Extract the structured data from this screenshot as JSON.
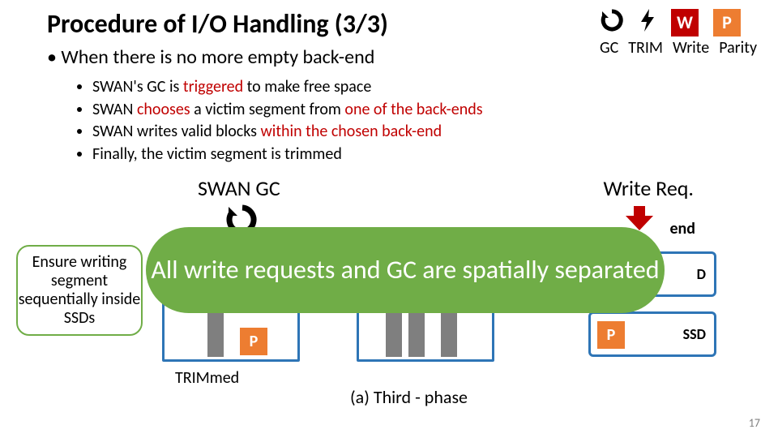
{
  "title": "Procedure of I/O Handling (3/3)",
  "legend": {
    "w": "W",
    "p": "P",
    "gc": "GC",
    "trim": "TRIM",
    "write": "Write",
    "parity": "Parity"
  },
  "main_bullet": "When there is no more empty back-end",
  "sub": {
    "a_pre": "SWAN's GC is ",
    "a_em": "triggered",
    "a_post": " to make free space",
    "b_pre": "SWAN ",
    "b_em": "chooses",
    "b_mid": " a victim segment from ",
    "b_em2": "one of the back-ends",
    "c_pre": "SWAN writes valid blocks ",
    "c_em": "within the chosen back-end",
    "d": "Finally, the victim segment is trimmed"
  },
  "swangc": "SWAN GC",
  "writereq": "Write Req.",
  "frontend_label": "end",
  "callout": "Ensure writing segment sequentially inside SSDs",
  "banner": "All write requests and GC are spatially separated",
  "trimmed": "TRIMmed",
  "phase": "(a) Third - phase",
  "pagenum": "17",
  "ssd_label": "SSD",
  "ssd_label_partial": "D",
  "p_label": "P"
}
